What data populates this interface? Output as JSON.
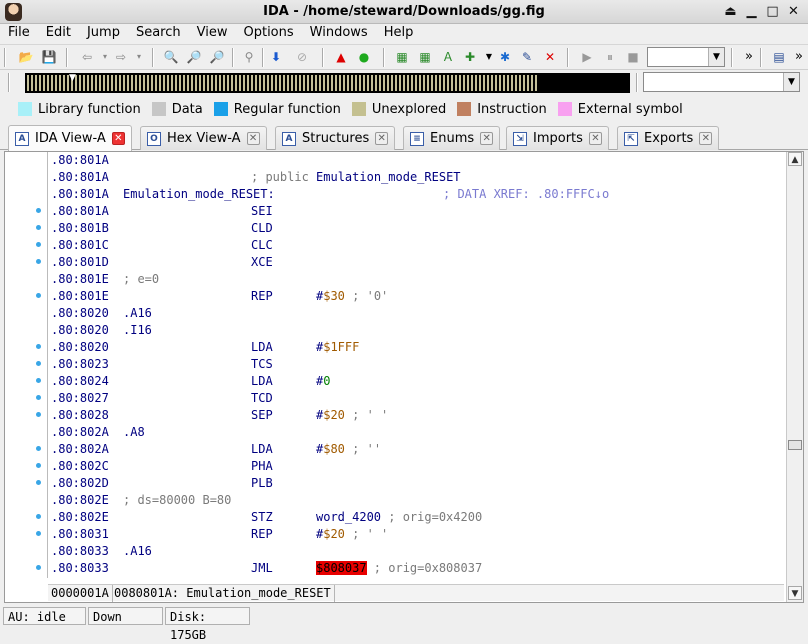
{
  "window": {
    "title": "IDA - /home/steward/Downloads/gg.fig"
  },
  "menu": [
    "File",
    "Edit",
    "Jump",
    "Search",
    "View",
    "Options",
    "Windows",
    "Help"
  ],
  "legend": [
    {
      "label": "Library function",
      "color": "#a8f0f8"
    },
    {
      "label": "Data",
      "color": "#c6c6c6"
    },
    {
      "label": "Regular function",
      "color": "#1aa0e8"
    },
    {
      "label": "Unexplored",
      "color": "#c4c090"
    },
    {
      "label": "Instruction",
      "color": "#c08060"
    },
    {
      "label": "External symbol",
      "color": "#f8a0f0"
    }
  ],
  "tabs": [
    {
      "label": "IDA View-A",
      "icon": "ida-view-icon"
    },
    {
      "label": "Hex View-A",
      "icon": "hex-view-icon"
    },
    {
      "label": "Structures",
      "icon": "structures-icon"
    },
    {
      "label": "Enums",
      "icon": "enums-icon"
    },
    {
      "label": "Imports",
      "icon": "imports-icon"
    },
    {
      "label": "Exports",
      "icon": "exports-icon"
    }
  ],
  "disasm": {
    "lines": [
      {
        "addr": ".80:801A",
        "dot": false
      },
      {
        "addr": ".80:801A",
        "dot": false,
        "text": "; public ",
        "label": "Emulation_mode_RESET",
        "kind": "public"
      },
      {
        "addr": ".80:801A",
        "dot": false,
        "label": "Emulation_mode_RESET:",
        "xref": "; DATA XREF: .80:FFFC↓o",
        "kind": "label"
      },
      {
        "addr": ".80:801A",
        "dot": true,
        "mnem": "SEI"
      },
      {
        "addr": ".80:801B",
        "dot": true,
        "mnem": "CLD"
      },
      {
        "addr": ".80:801C",
        "dot": true,
        "mnem": "CLC"
      },
      {
        "addr": ".80:801D",
        "dot": true,
        "mnem": "XCE"
      },
      {
        "addr": ".80:801E",
        "dot": false,
        "comment": "; e=0",
        "kind": "note"
      },
      {
        "addr": ".80:801E",
        "dot": true,
        "mnem": "REP",
        "op": "#",
        "val": "$30",
        "cmt": " ; '0'"
      },
      {
        "addr": ".80:8020",
        "dot": false,
        "dir": ".A16"
      },
      {
        "addr": ".80:8020",
        "dot": false,
        "dir": ".I16"
      },
      {
        "addr": ".80:8020",
        "dot": true,
        "mnem": "LDA",
        "op": "#",
        "val": "$1FFF"
      },
      {
        "addr": ".80:8023",
        "dot": true,
        "mnem": "TCS"
      },
      {
        "addr": ".80:8024",
        "dot": true,
        "mnem": "LDA",
        "op": "#",
        "num": "0"
      },
      {
        "addr": ".80:8027",
        "dot": true,
        "mnem": "TCD"
      },
      {
        "addr": ".80:8028",
        "dot": true,
        "mnem": "SEP",
        "op": "#",
        "val": "$20",
        "cmt": " ; ' '"
      },
      {
        "addr": ".80:802A",
        "dot": false,
        "dir": ".A8"
      },
      {
        "addr": ".80:802A",
        "dot": true,
        "mnem": "LDA",
        "op": "#",
        "val": "$80",
        "cmt": " ; ''"
      },
      {
        "addr": ".80:802C",
        "dot": true,
        "mnem": "PHA"
      },
      {
        "addr": ".80:802D",
        "dot": true,
        "mnem": "PLB"
      },
      {
        "addr": ".80:802E",
        "dot": false,
        "comment": "; ds=80000 B=80",
        "kind": "note"
      },
      {
        "addr": ".80:802E",
        "dot": true,
        "mnem": "STZ",
        "opname": "word_4200",
        "cmt": " ; orig=0x4200"
      },
      {
        "addr": ".80:8031",
        "dot": true,
        "mnem": "REP",
        "op": "#",
        "val": "$20",
        "cmt": " ; ' '"
      },
      {
        "addr": ".80:8033",
        "dot": false,
        "dir": ".A16"
      },
      {
        "addr": ".80:8033",
        "dot": true,
        "mnem": "JML",
        "hl": "$808037",
        "cmt": " ; orig=0x808037"
      }
    ]
  },
  "view_status": {
    "offset": "0000001A",
    "location": "0080801A: Emulation_mode_RESET"
  },
  "statusbar": {
    "au": "AU:  idle",
    "dir": "Down",
    "disk": "Disk: 175GB"
  },
  "toolbar": {
    "more": "»"
  }
}
